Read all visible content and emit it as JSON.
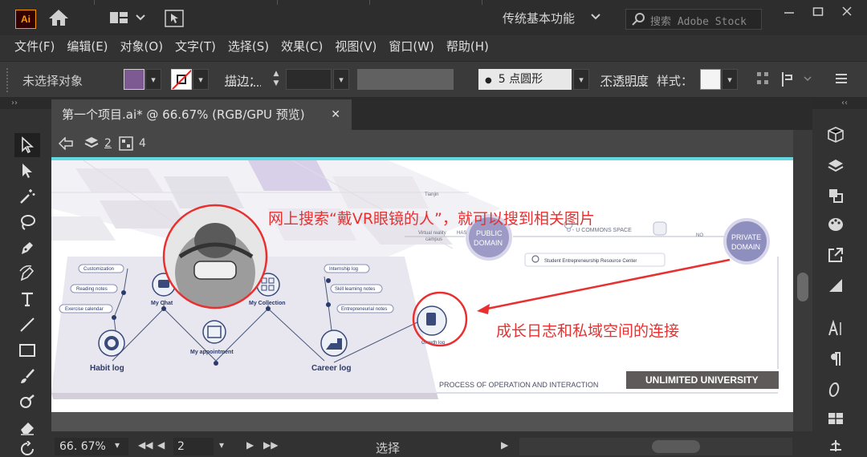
{
  "app": {
    "logo_text": "Ai",
    "workspace": "传统基本功能",
    "search_placeholder": "搜索 Adobe Stock"
  },
  "menu": [
    "文件(F)",
    "编辑(E)",
    "对象(O)",
    "文字(T)",
    "选择(S)",
    "效果(C)",
    "视图(V)",
    "窗口(W)",
    "帮助(H)"
  ],
  "control": {
    "selection_status": "未选择对象",
    "fill_color": "#7e5a93",
    "stroke_label": "描边：",
    "brush": "5 点圆形",
    "opacity_label": "不透明度",
    "style_label": "样式："
  },
  "document": {
    "tab_title": "第一个项目.ai* @ 66.67% (RGB/GPU 预览)",
    "close": "✕",
    "isolation_layer": "2",
    "isolation_group": "4"
  },
  "artwork": {
    "annotation_top": "网上搜索“戴VR眼镜的人”，就可以搜到相关图片",
    "annotation_bottom": "成长日志和私域空间的连接",
    "annotation_color": "#e83030",
    "labels": {
      "tianjin": "Tianjin",
      "virtual_campus_1": "Virtual reality",
      "virtual_campus_2": "campus",
      "has": "HAS",
      "public_domain_1": "PUBLIC",
      "public_domain_2": "DOMAIN",
      "commons": "U - U   COMMONS SPACE",
      "no": "NO",
      "private_domain_1": "PRIVATE",
      "private_domain_2": "DOMAIN",
      "search_center": "Student Entrepreneurship Resource Center",
      "customization": "Customization",
      "reading_notes": "Reading notes",
      "exercise_calendar": "Exercise calendar",
      "my_chat": "My Chat",
      "my_collection": "My Collection",
      "internship_log": "Internship log",
      "skill_learning_notes": "Skill learning notes",
      "entrepreneurial_notes": "Entrepreneurial notes",
      "my_appointment": "My appointment",
      "habit_log": "Habit log",
      "career_log": "Career log",
      "growth_log": "Growth log",
      "process": "PROCESS  OF  OPERATION  AND  INTERACTION",
      "unlimited": "UNLIMITED UNIVERSITY"
    }
  },
  "status": {
    "zoom": "66. 67%",
    "page": "2",
    "tool": "选择"
  },
  "colors": {
    "ui_dark": "#323232",
    "canvas": "#535353",
    "accent_cyan": "#63d7e0",
    "domain_purple": "#8f8fbf"
  }
}
